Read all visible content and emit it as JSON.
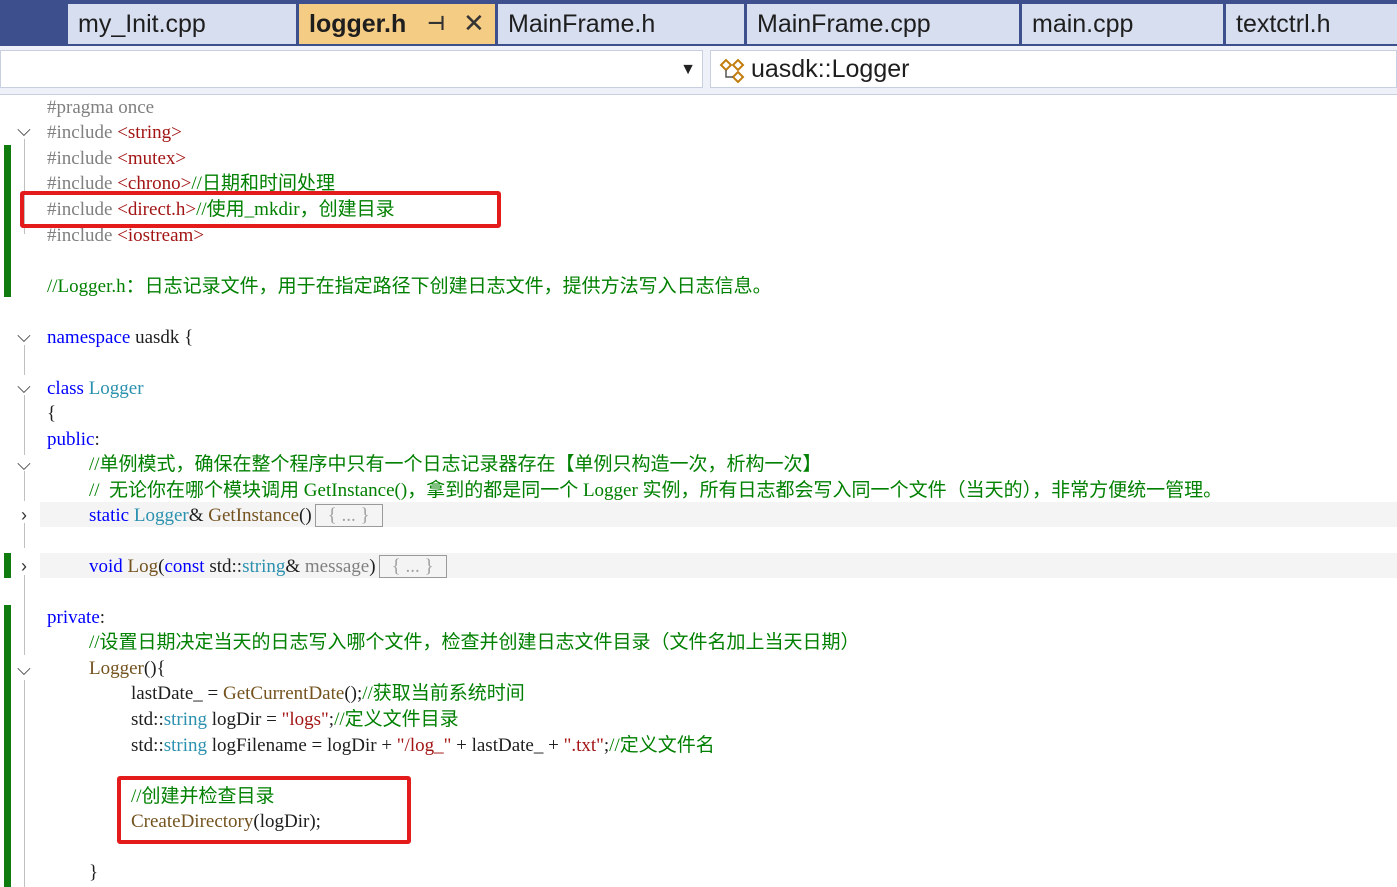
{
  "tabs": [
    {
      "label": "my_Init.cpp"
    },
    {
      "label": "logger.h",
      "active": true,
      "pin_icon": "pin-icon",
      "close_icon": "close-icon"
    },
    {
      "label": "MainFrame.h"
    },
    {
      "label": "MainFrame.cpp"
    },
    {
      "label": "main.cpp"
    },
    {
      "label": "textctrl.h"
    }
  ],
  "navbar": {
    "left_dropdown_icon": "chevron-down-icon",
    "right_dropdown_icon": "class-icon",
    "right_dropdown_label": "uasdk::Logger"
  },
  "code": {
    "l1": {
      "pp": "#pragma once"
    },
    "l2": {
      "pp": "#include ",
      "inc": "<string>"
    },
    "l3": {
      "pp": "#include ",
      "inc": "<mutex>"
    },
    "l4": {
      "pp": "#include ",
      "inc": "<chrono>",
      "cm": "//日期和时间处理"
    },
    "l5": {
      "pp": "#include ",
      "inc": "<direct.h>",
      "cm": "//使用_mkdir，创建目录"
    },
    "l6": {
      "pp": "#include ",
      "inc": "<iostream>"
    },
    "l8": {
      "cm": "//Logger.h：日志记录文件，用于在指定路径下创建日志文件，提供方法写入日志信息。"
    },
    "l10": {
      "kw": "namespace",
      "rest": " uasdk {"
    },
    "l12": {
      "kw": "class",
      "ty": "Logger"
    },
    "l13": {
      "text": "{"
    },
    "l14": {
      "kw": "public",
      "rest": ":"
    },
    "l15": {
      "cm": "//单例模式，确保在整个程序中只有一个日志记录器存在【单例只构造一次，析构一次】"
    },
    "l16": {
      "cm": "//  无论你在哪个模块调用 GetInstance()，拿到的都是同一个 Logger 实例，所有日志都会写入同一个文件（当天的），非常方便统一管理。"
    },
    "l17": {
      "kw": "static",
      "ty": "Logger",
      "amp": "& ",
      "fn": "GetInstance",
      "paren": "()",
      "collapsed": "{ ... }"
    },
    "l19": {
      "kw": "void",
      "fn": "Log",
      "open": "(",
      "kw2": "const",
      "ns": " std::",
      "ty": "string",
      "amp": "& ",
      "par": "message",
      "close": ")",
      "collapsed": "{ ... }"
    },
    "l21": {
      "kw": "private",
      "rest": ":"
    },
    "l22": {
      "cm": "//设置日期决定当天的日志写入哪个文件，检查并创建日志文件目录（文件名加上当天日期）"
    },
    "l23": {
      "fn": "Logger",
      "rest": "(){"
    },
    "l24": {
      "a": "lastDate_ = ",
      "fn": "GetCurrentDate",
      "b": "();",
      "cm": "//获取当前系统时间"
    },
    "l25": {
      "ns": "std::",
      "ty": "string",
      "a": " logDir = ",
      "str": "\"logs\"",
      "b": ";",
      "cm": "//定义文件目录"
    },
    "l26": {
      "ns": "std::",
      "ty": "string",
      "a": " logFilename = logDir + ",
      "str1": "\"/log_\"",
      "b": " + lastDate_ + ",
      "str2": "\".txt\"",
      "c": ";",
      "cm": "//定义文件名"
    },
    "l28": {
      "cm": "//创建并检查目录"
    },
    "l29": {
      "fn": "CreateDirectory",
      "rest": "(logDir);"
    },
    "l31": {
      "text": "}"
    }
  }
}
